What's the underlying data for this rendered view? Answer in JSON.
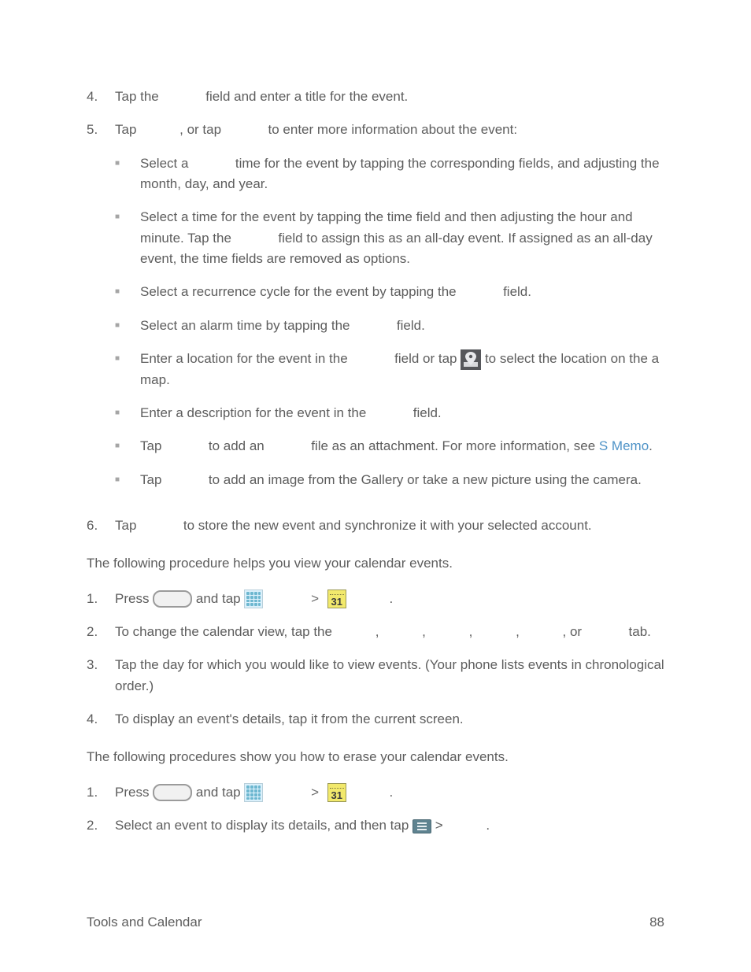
{
  "ol_continue": {
    "items": [
      {
        "num": "4.",
        "segments": [
          {
            "t": "text",
            "val": "Tap the "
          },
          {
            "t": "gap"
          },
          {
            "t": "text",
            "val": " field and enter a title for the event."
          }
        ]
      },
      {
        "num": "5.",
        "segments": [
          {
            "t": "text",
            "val": "Tap "
          },
          {
            "t": "gap"
          },
          {
            "t": "text",
            "val": ", or tap "
          },
          {
            "t": "gap"
          },
          {
            "t": "text",
            "val": " to enter more information about the event:"
          }
        ],
        "sub": [
          {
            "segments": [
              {
                "t": "text",
                "val": "Select a "
              },
              {
                "t": "gap"
              },
              {
                "t": "text",
                "val": " time for the event by tapping the corresponding fields, and adjusting the month, day, and year."
              }
            ]
          },
          {
            "segments": [
              {
                "t": "text",
                "val": "Select a time for the event by tapping the time field and then adjusting the hour and minute. Tap the "
              },
              {
                "t": "gap"
              },
              {
                "t": "text",
                "val": " field to assign this as an all-day event. If assigned as an all-day event, the time fields are removed as options."
              }
            ]
          },
          {
            "segments": [
              {
                "t": "text",
                "val": "Select a recurrence cycle for the event by tapping the "
              },
              {
                "t": "gap"
              },
              {
                "t": "text",
                "val": " field."
              }
            ]
          },
          {
            "segments": [
              {
                "t": "text",
                "val": "Select an alarm time by tapping the "
              },
              {
                "t": "gap"
              },
              {
                "t": "text",
                "val": " field."
              }
            ]
          },
          {
            "segments": [
              {
                "t": "text",
                "val": "Enter a location for the event in the "
              },
              {
                "t": "gap"
              },
              {
                "t": "text",
                "val": " field or tap "
              },
              {
                "t": "icon",
                "name": "map-marker-icon"
              },
              {
                "t": "text",
                "val": " to select the location on the a map."
              }
            ]
          },
          {
            "segments": [
              {
                "t": "text",
                "val": "Enter a description for the event in the "
              },
              {
                "t": "gap"
              },
              {
                "t": "text",
                "val": " field."
              }
            ]
          },
          {
            "segments": [
              {
                "t": "text",
                "val": "Tap "
              },
              {
                "t": "gap"
              },
              {
                "t": "text",
                "val": " to add an "
              },
              {
                "t": "gap"
              },
              {
                "t": "text",
                "val": " file as an attachment. For more information, see "
              },
              {
                "t": "link",
                "val": "S Memo"
              },
              {
                "t": "text",
                "val": "."
              }
            ]
          },
          {
            "segments": [
              {
                "t": "text",
                "val": "Tap "
              },
              {
                "t": "gap"
              },
              {
                "t": "text",
                "val": " to add an image from the Gallery or take a new picture using the camera."
              }
            ]
          }
        ]
      },
      {
        "num": "6.",
        "segments": [
          {
            "t": "text",
            "val": "Tap "
          },
          {
            "t": "gap"
          },
          {
            "t": "text",
            "val": " to store the new event and synchronize it with your selected account."
          }
        ]
      }
    ]
  },
  "view_section": {
    "intro": "The following procedure helps you view your calendar events.",
    "steps": [
      {
        "num": "1.",
        "segments": [
          {
            "t": "text",
            "val": "Press "
          },
          {
            "t": "icon",
            "name": "home-button-icon"
          },
          {
            "t": "text",
            "val": " and tap "
          },
          {
            "t": "icon",
            "name": "apps-grid-icon"
          },
          {
            "t": "gap"
          },
          {
            "t": "gt"
          },
          {
            "t": "icon",
            "name": "calendar-icon"
          },
          {
            "t": "gap"
          },
          {
            "t": "text",
            "val": "."
          }
        ]
      },
      {
        "num": "2.",
        "segments": [
          {
            "t": "text",
            "val": "To change the calendar view, tap the "
          },
          {
            "t": "gap"
          },
          {
            "t": "text",
            "val": ", "
          },
          {
            "t": "gap"
          },
          {
            "t": "text",
            "val": ", "
          },
          {
            "t": "gap"
          },
          {
            "t": "text",
            "val": ", "
          },
          {
            "t": "gap"
          },
          {
            "t": "text",
            "val": ", "
          },
          {
            "t": "gap"
          },
          {
            "t": "text",
            "val": ", or "
          },
          {
            "t": "gap"
          },
          {
            "t": "text",
            "val": " tab."
          }
        ]
      },
      {
        "num": "3.",
        "segments": [
          {
            "t": "text",
            "val": "Tap the day for which you would like to view events. (Your phone lists events in chronological order.)"
          }
        ]
      },
      {
        "num": "4.",
        "segments": [
          {
            "t": "text",
            "val": "To display an event's details, tap it from the current screen."
          }
        ]
      }
    ]
  },
  "erase_section": {
    "intro": "The following procedures show you how to erase your calendar events.",
    "steps": [
      {
        "num": "1.",
        "segments": [
          {
            "t": "text",
            "val": "Press "
          },
          {
            "t": "icon",
            "name": "home-button-icon"
          },
          {
            "t": "text",
            "val": " and tap "
          },
          {
            "t": "icon",
            "name": "apps-grid-icon"
          },
          {
            "t": "gap"
          },
          {
            "t": "gt"
          },
          {
            "t": "icon",
            "name": "calendar-icon"
          },
          {
            "t": "gap"
          },
          {
            "t": "text",
            "val": "."
          }
        ]
      },
      {
        "num": "2.",
        "segments": [
          {
            "t": "text",
            "val": "Select an event to display its details, and then tap "
          },
          {
            "t": "icon",
            "name": "menu-button-icon"
          },
          {
            "t": "text",
            "val": " > "
          },
          {
            "t": "gap"
          },
          {
            "t": "text",
            "val": "."
          }
        ]
      }
    ]
  },
  "footer": {
    "left": "Tools and Calendar",
    "right": "88"
  },
  "calendar_day": "31",
  "gt_symbol": ">"
}
